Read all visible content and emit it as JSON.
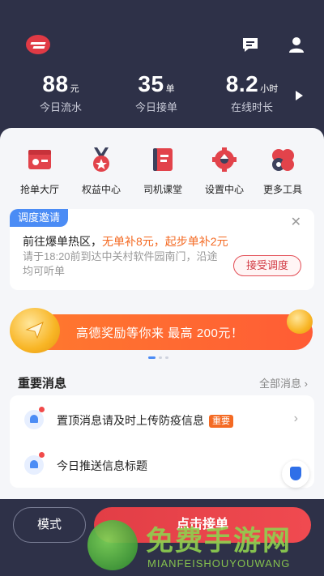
{
  "header": {
    "logo": "driver-app-logo",
    "icons": [
      "message-icon",
      "user-icon"
    ]
  },
  "stats": [
    {
      "value": "88",
      "unit": "元",
      "label": "今日流水"
    },
    {
      "value": "35",
      "unit": "单",
      "label": "今日接单"
    },
    {
      "value": "8.2",
      "unit": "小时",
      "label": "在线时长"
    }
  ],
  "tools": [
    {
      "label": "抢单大厅",
      "icon": "order-hall-icon"
    },
    {
      "label": "权益中心",
      "icon": "rights-medal-icon"
    },
    {
      "label": "司机课堂",
      "icon": "classroom-book-icon"
    },
    {
      "label": "设置中心",
      "icon": "settings-gear-icon"
    },
    {
      "label": "更多工具",
      "icon": "more-tools-icon"
    }
  ],
  "invite": {
    "tag": "调度邀请",
    "title_prefix": "前往爆单热区，",
    "title_highlight": "无单补8元，起步单补2元",
    "desc": "请于18:20前到达中关村软件园南门，沿途均可听单",
    "accept_label": "接受调度",
    "close_glyph": "✕"
  },
  "banner": {
    "text": "高德奖励等你来 最高 200元！",
    "page_count": 3,
    "active_page": 1
  },
  "messages": {
    "title": "重要消息",
    "all_label": "全部消息 ›",
    "items": [
      {
        "text": "置顶消息请及时上传防疫信息",
        "badge": "重要"
      },
      {
        "text": "今日推送信息标题",
        "badge": ""
      }
    ]
  },
  "bottom": {
    "mode_label": "模式",
    "take_order_label": "点击接单"
  },
  "watermark": {
    "text": "免费手游网",
    "sub": "MIANFEISHOUYOUWANG"
  },
  "colors": {
    "header_bg": "#2e3148",
    "accent_red": "#e23e46",
    "accent_orange": "#f46a23",
    "accent_blue": "#4b8cf5"
  }
}
